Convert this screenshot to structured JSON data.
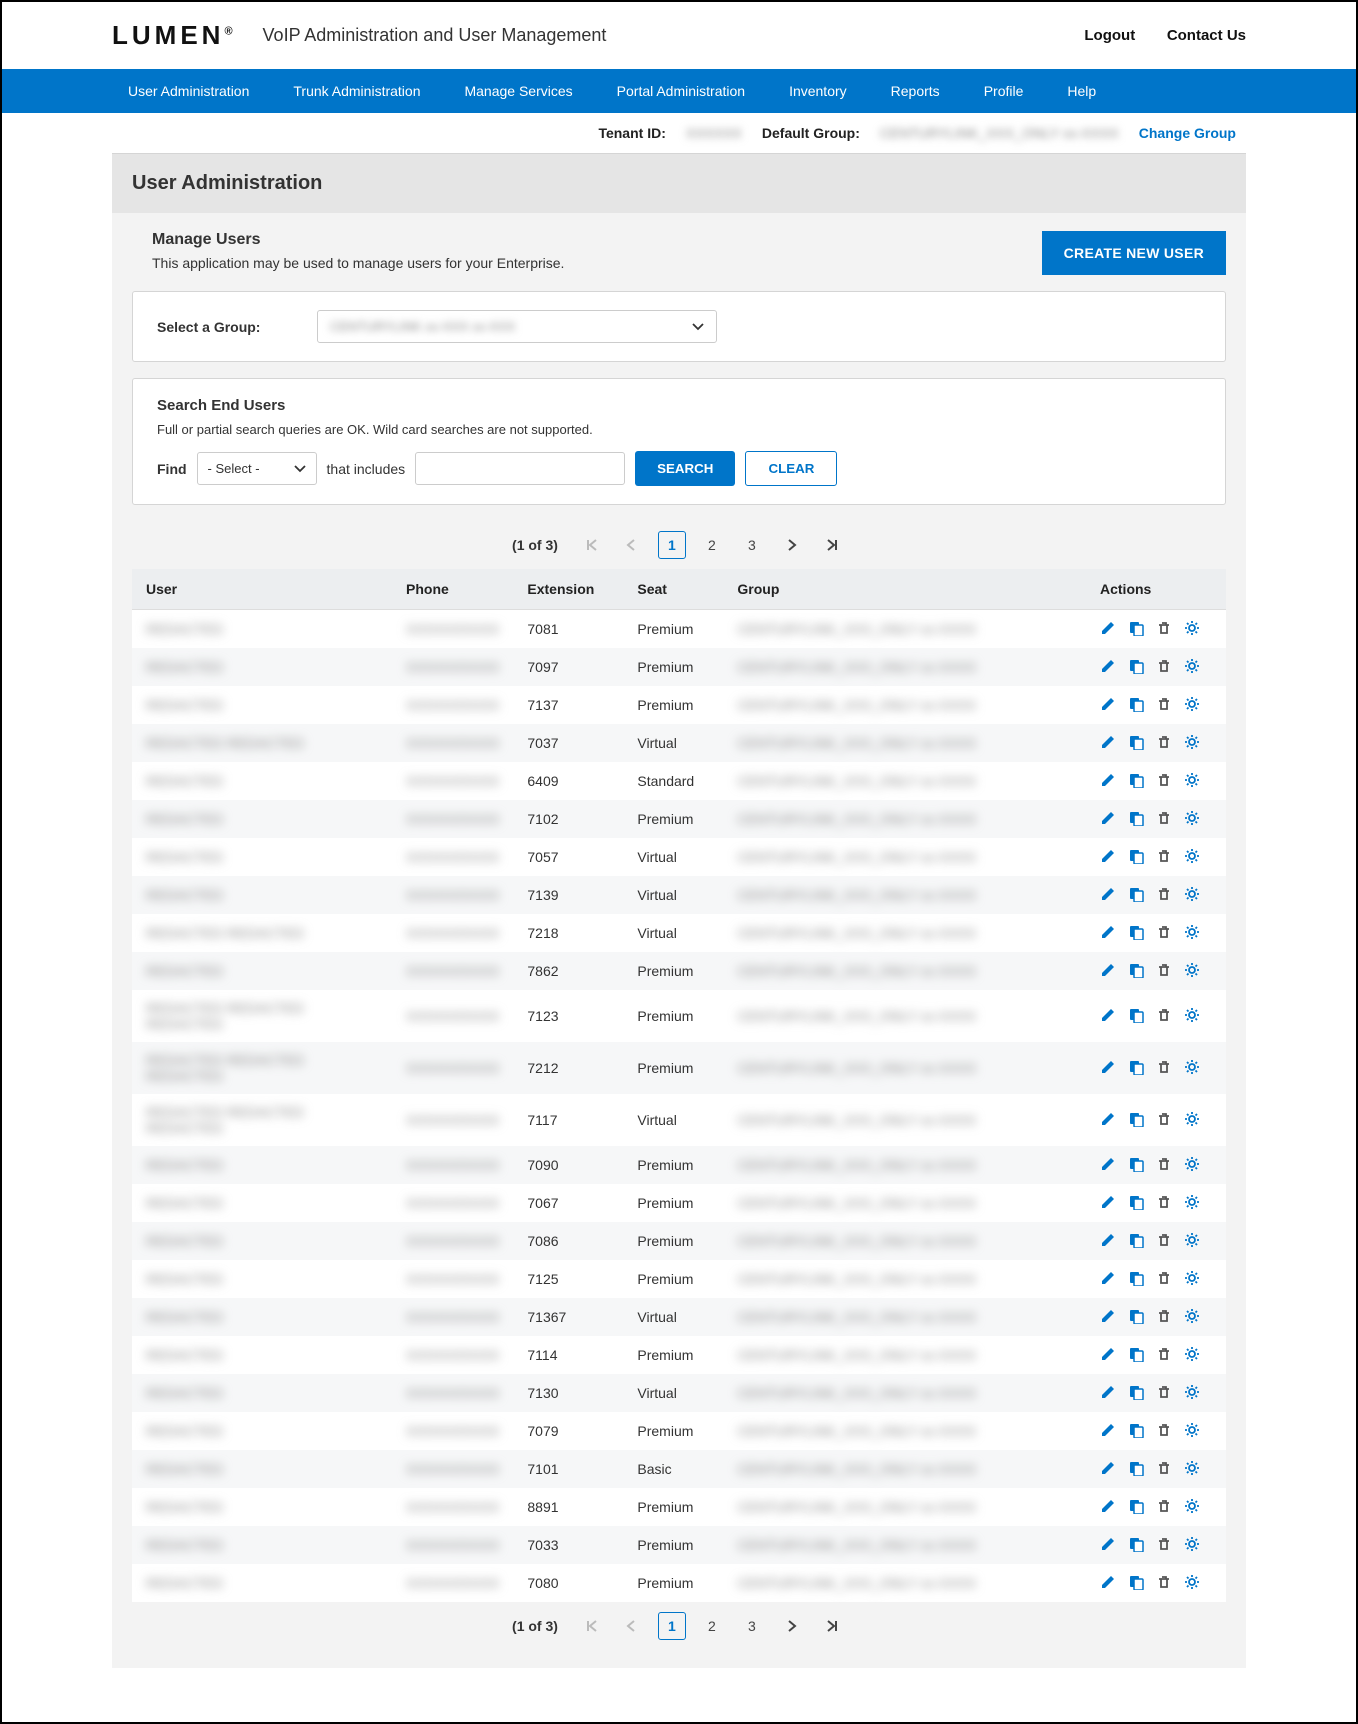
{
  "header": {
    "logo_text": "LUMEN",
    "subtitle": "VoIP Administration and User Management",
    "links": {
      "logout": "Logout",
      "contact": "Contact Us"
    }
  },
  "nav": {
    "items": [
      "User Administration",
      "Trunk Administration",
      "Manage Services",
      "Portal Administration",
      "Inventory",
      "Reports",
      "Profile",
      "Help"
    ]
  },
  "meta": {
    "tenant_label": "Tenant ID:",
    "tenant_value": "XXXXXX",
    "default_group_label": "Default Group:",
    "default_group_value": "CENTURYLINK_XXX_ONLY xx-XXXX",
    "change_group": "Change Group"
  },
  "page_title": "User Administration",
  "manage": {
    "title": "Manage Users",
    "desc": "This application may be used to manage users for your Enterprise.",
    "create_btn": "CREATE NEW USER"
  },
  "group_select": {
    "label": "Select a Group:",
    "value": "CENTURYLINK xx-XXX xx-XXX"
  },
  "search": {
    "title": "Search End Users",
    "hint": "Full or partial search queries are OK. Wild card searches are not supported.",
    "find_label": "Find",
    "select_placeholder": "- Select -",
    "includes_label": "that includes",
    "search_btn": "SEARCH",
    "clear_btn": "CLEAR"
  },
  "pager": {
    "count_text": "(1 of 3)",
    "pages": [
      "1",
      "2",
      "3"
    ],
    "active_index": 0
  },
  "table": {
    "headers": {
      "user": "User",
      "phone": "Phone",
      "extension": "Extension",
      "seat": "Seat",
      "group": "Group",
      "actions": "Actions"
    },
    "rows": [
      {
        "user": "REDACTED",
        "phone": "XXXXXXXXXX",
        "extension": "7081",
        "seat": "Premium",
        "group": "CENTURYLINK_XXX_ONLY xx-XXXX"
      },
      {
        "user": "REDACTED",
        "phone": "XXXXXXXXXX",
        "extension": "7097",
        "seat": "Premium",
        "group": "CENTURYLINK_XXX_ONLY xx-XXXX"
      },
      {
        "user": "REDACTED",
        "phone": "XXXXXXXXXX",
        "extension": "7137",
        "seat": "Premium",
        "group": "CENTURYLINK_XXX_ONLY xx-XXXX"
      },
      {
        "user": "REDACTED REDACTED",
        "phone": "XXXXXXXXXX",
        "extension": "7037",
        "seat": "Virtual",
        "group": "CENTURYLINK_XXX_ONLY xx-XXXX"
      },
      {
        "user": "REDACTED",
        "phone": "XXXXXXXXXX",
        "extension": "6409",
        "seat": "Standard",
        "group": "CENTURYLINK_XXX_ONLY xx-XXXX"
      },
      {
        "user": "REDACTED",
        "phone": "XXXXXXXXXX",
        "extension": "7102",
        "seat": "Premium",
        "group": "CENTURYLINK_XXX_ONLY xx-XXXX"
      },
      {
        "user": "REDACTED",
        "phone": "XXXXXXXXXX",
        "extension": "7057",
        "seat": "Virtual",
        "group": "CENTURYLINK_XXX_ONLY xx-XXXX"
      },
      {
        "user": "REDACTED",
        "phone": "XXXXXXXXXX",
        "extension": "7139",
        "seat": "Virtual",
        "group": "CENTURYLINK_XXX_ONLY xx-XXXX"
      },
      {
        "user": "REDACTED REDACTED",
        "phone": "XXXXXXXXXX",
        "extension": "7218",
        "seat": "Virtual",
        "group": "CENTURYLINK_XXX_ONLY xx-XXXX"
      },
      {
        "user": "REDACTED",
        "phone": "XXXXXXXXXX",
        "extension": "7862",
        "seat": "Premium",
        "group": "CENTURYLINK_XXX_ONLY xx-XXXX"
      },
      {
        "user": "REDACTED REDACTED REDACTED",
        "phone": "XXXXXXXXXX",
        "extension": "7123",
        "seat": "Premium",
        "group": "CENTURYLINK_XXX_ONLY xx-XXXX"
      },
      {
        "user": "REDACTED REDACTED REDACTED",
        "phone": "XXXXXXXXXX",
        "extension": "7212",
        "seat": "Premium",
        "group": "CENTURYLINK_XXX_ONLY xx-XXXX"
      },
      {
        "user": "REDACTED REDACTED REDACTED",
        "phone": "XXXXXXXXXX",
        "extension": "7117",
        "seat": "Virtual",
        "group": "CENTURYLINK_XXX_ONLY xx-XXXX"
      },
      {
        "user": "REDACTED",
        "phone": "XXXXXXXXXX",
        "extension": "7090",
        "seat": "Premium",
        "group": "CENTURYLINK_XXX_ONLY xx-XXXX"
      },
      {
        "user": "REDACTED",
        "phone": "XXXXXXXXXX",
        "extension": "7067",
        "seat": "Premium",
        "group": "CENTURYLINK_XXX_ONLY xx-XXXX"
      },
      {
        "user": "REDACTED",
        "phone": "XXXXXXXXXX",
        "extension": "7086",
        "seat": "Premium",
        "group": "CENTURYLINK_XXX_ONLY xx-XXXX"
      },
      {
        "user": "REDACTED",
        "phone": "XXXXXXXXXX",
        "extension": "7125",
        "seat": "Premium",
        "group": "CENTURYLINK_XXX_ONLY xx-XXXX"
      },
      {
        "user": "REDACTED",
        "phone": "XXXXXXXXXX",
        "extension": "71367",
        "seat": "Virtual",
        "group": "CENTURYLINK_XXX_ONLY xx-XXXX"
      },
      {
        "user": "REDACTED",
        "phone": "XXXXXXXXXX",
        "extension": "7114",
        "seat": "Premium",
        "group": "CENTURYLINK_XXX_ONLY xx-XXXX"
      },
      {
        "user": "REDACTED",
        "phone": "XXXXXXXXXX",
        "extension": "7130",
        "seat": "Virtual",
        "group": "CENTURYLINK_XXX_ONLY xx-XXXX"
      },
      {
        "user": "REDACTED",
        "phone": "XXXXXXXXXX",
        "extension": "7079",
        "seat": "Premium",
        "group": "CENTURYLINK_XXX_ONLY xx-XXXX"
      },
      {
        "user": "REDACTED",
        "phone": "XXXXXXXXXX",
        "extension": "7101",
        "seat": "Basic",
        "group": "CENTURYLINK_XXX_ONLY xx-XXXX"
      },
      {
        "user": "REDACTED",
        "phone": "XXXXXXXXXX",
        "extension": "8891",
        "seat": "Premium",
        "group": "CENTURYLINK_XXX_ONLY xx-XXXX"
      },
      {
        "user": "REDACTED",
        "phone": "XXXXXXXXXX",
        "extension": "7033",
        "seat": "Premium",
        "group": "CENTURYLINK_XXX_ONLY xx-XXXX"
      },
      {
        "user": "REDACTED",
        "phone": "XXXXXXXXXX",
        "extension": "7080",
        "seat": "Premium",
        "group": "CENTURYLINK_XXX_ONLY xx-XXXX"
      }
    ]
  }
}
